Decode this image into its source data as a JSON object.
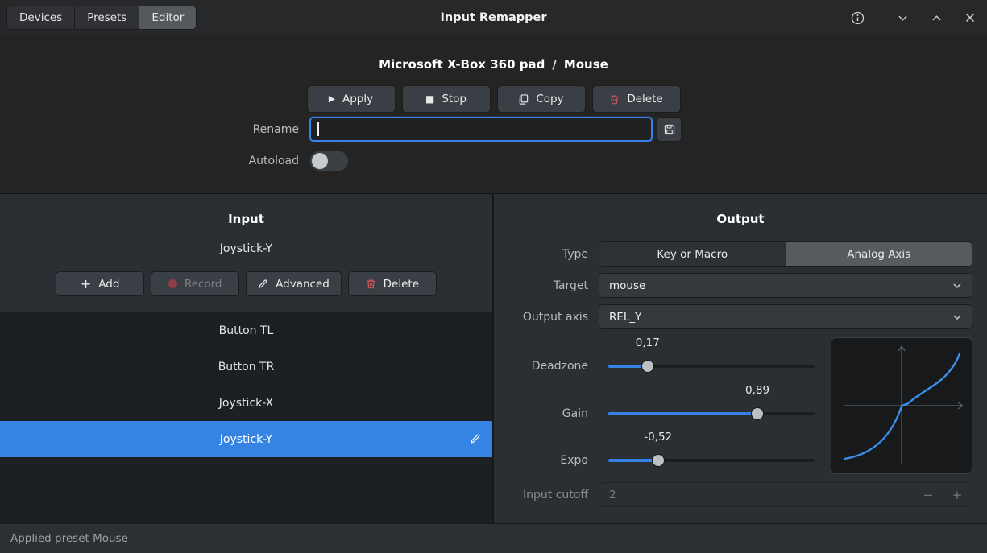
{
  "titlebar": {
    "tabs": [
      "Devices",
      "Presets",
      "Editor"
    ],
    "active_tab": "Editor",
    "title": "Input Remapper"
  },
  "preset_header": {
    "device": "Microsoft X-Box 360 pad",
    "separator": "/",
    "preset": "Mouse",
    "actions": {
      "apply": "Apply",
      "stop": "Stop",
      "copy": "Copy",
      "delete": "Delete"
    },
    "rename_label": "Rename",
    "rename_value": "",
    "autoload_label": "Autoload",
    "autoload_on": false
  },
  "input_panel": {
    "title": "Input",
    "current": "Joystick-Y",
    "buttons": {
      "add": "Add",
      "record": "Record",
      "advanced": "Advanced",
      "delete": "Delete"
    },
    "record_disabled": true,
    "items": [
      "Button TL",
      "Button TR",
      "Joystick-X",
      "Joystick-Y"
    ],
    "selected_item": "Joystick-Y"
  },
  "output_panel": {
    "title": "Output",
    "type_label": "Type",
    "type_options": [
      "Key or Macro",
      "Analog Axis"
    ],
    "type_selected": "Analog Axis",
    "target_label": "Target",
    "target_value": "mouse",
    "output_axis_label": "Output axis",
    "output_axis_value": "REL_Y",
    "sliders": [
      {
        "label": "Deadzone",
        "value": "0,17",
        "percent": 19
      },
      {
        "label": "Gain",
        "value": "0,89",
        "percent": 72
      },
      {
        "label": "Expo",
        "value": "-0,52",
        "percent": 24
      }
    ],
    "input_cutoff_label": "Input cutoff",
    "input_cutoff_value": "2",
    "input_cutoff_disabled": true
  },
  "statusbar": {
    "text": "Applied preset Mouse"
  },
  "colors": {
    "accent": "#3584e4",
    "delete_red": "#d05358",
    "record_dot": "#8e3d44",
    "curve_blue": "#3d8ee8"
  },
  "icons": {
    "apply": "play-icon",
    "stop": "stop-icon",
    "copy": "copy-icon",
    "delete": "trash-icon",
    "save": "floppy-icon",
    "add": "plus-icon",
    "record": "record-dot-icon",
    "advanced": "pencil-icon",
    "edit": "pencil-icon",
    "dropdown": "chevron-down-icon",
    "info": "info-icon",
    "minimize": "chevron-down-icon",
    "maximize": "chevron-up-icon",
    "close": "close-icon"
  }
}
